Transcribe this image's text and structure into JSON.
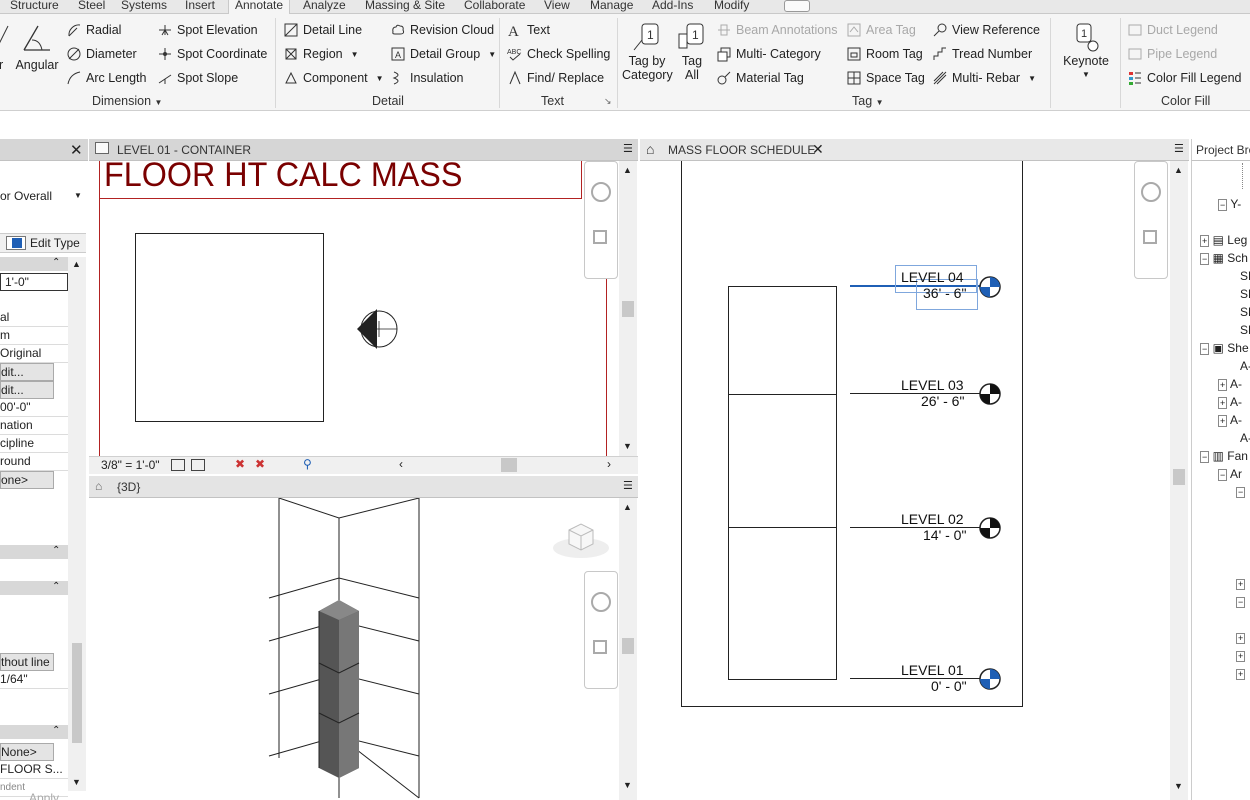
{
  "ribbon_tabs": [
    "Structure",
    "Steel",
    "Systems",
    "Insert",
    "Annotate",
    "Analyze",
    "Massing & Site",
    "Collaborate",
    "View",
    "Manage",
    "Add-Ins",
    "Modify"
  ],
  "dimension_panel": {
    "aligned_label": "ar",
    "angular_label": "Angular",
    "radial_label": "Radial",
    "diameter_label": "Diameter",
    "arc_length_label": "Arc  Length",
    "spot_elevation_label": "Spot Elevation",
    "spot_coordinate_label": "Spot Coordinate",
    "spot_slope_label": "Spot Slope",
    "panel_label": "Dimension"
  },
  "detail_panel": {
    "detail_line_label": "Detail  Line",
    "region_label": "Region",
    "component_label": "Component",
    "revision_cloud_label": "Revision  Cloud",
    "detail_group_label": "Detail  Group",
    "insulation_label": "Insulation",
    "panel_label": "Detail"
  },
  "text_panel": {
    "text_label": "Text",
    "check_spelling_label": "Check  Spelling",
    "find_replace_label": "Find/  Replace",
    "panel_label": "Text"
  },
  "tag_panel": {
    "tag_by_category_line1": "Tag by",
    "tag_by_category_line2": "Category",
    "tag_all_line1": "Tag",
    "tag_all_line2": "All",
    "beam_annotations_label": "Beam  Annotations",
    "multi_category_label": "Multi- Category",
    "material_tag_label": "Material  Tag",
    "area_tag_label": "Area  Tag",
    "room_tag_label": "Room  Tag",
    "space_tag_label": "Space  Tag",
    "view_reference_label": "View  Reference",
    "tread_number_label": "Tread  Number",
    "multi_rebar_label": "Multi- Rebar",
    "keynote_label": "Keynote",
    "panel_label": "Tag"
  },
  "color_fill_panel": {
    "duct_legend_label": "Duct  Legend",
    "pipe_legend_label": "Pipe  Legend",
    "color_fill_legend_label": "Color Fill  Legend",
    "panel_label": "Color Fill"
  },
  "properties": {
    "type_selector_value": "or Overall",
    "edit_type_label": "Edit Type",
    "rows": [
      "1'-0\"",
      "al",
      "m",
      "Original",
      "dit...",
      "dit...",
      "00'-0\"",
      "nation",
      "cipline",
      "round",
      "one>"
    ],
    "lower_rows": [
      "thout line",
      "1/64\""
    ],
    "bottom_rows": [
      "None>",
      "FLOOR S...",
      "ndent"
    ],
    "apply_label": "Apply"
  },
  "view_level01": {
    "tab_title": "LEVEL 01 - CONTAINER",
    "title_text": "FLOOR HT CALC MASS",
    "scale_label": "3/8\" = 1'-0\""
  },
  "view_3d": {
    "tab_title": "{3D}"
  },
  "view_schedule": {
    "tab_title": "MASS FLOOR SCHEDULE",
    "levels": [
      {
        "name": "LEVEL 04",
        "elevation": "36' - 6\""
      },
      {
        "name": "LEVEL 03",
        "elevation": "26' - 6\""
      },
      {
        "name": "LEVEL 02",
        "elevation": "14' - 0\""
      },
      {
        "name": "LEVEL 01",
        "elevation": "0' - 0\""
      }
    ]
  },
  "project_browser": {
    "title": "Project Bro",
    "rows": [
      "Y-",
      "Leg",
      "Sch",
      "SH",
      "SH",
      "SH",
      "SH",
      "She",
      "A-",
      "A-",
      "A-",
      "A-",
      "A-",
      "Fan",
      "Ar"
    ]
  },
  "colors": {
    "title_red": "#7a0000",
    "crop_red": "#b22222",
    "level_blue": "#1f5fb5",
    "panel_header": "#d6d6d6"
  }
}
